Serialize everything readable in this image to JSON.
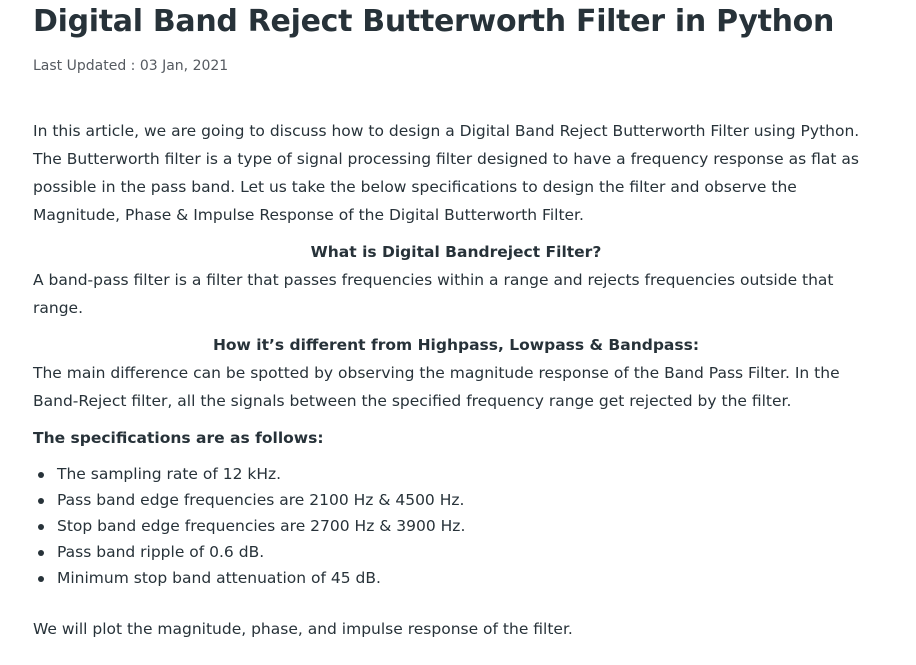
{
  "article": {
    "title": "Digital Band Reject Butterworth Filter in Python",
    "last_updated": "Last Updated : 03 Jan, 2021",
    "intro": "In this article, we are going to discuss how to design a Digital Band Reject Butterworth Filter using Python. The Butterworth filter is a type of signal processing filter designed to have a frequency response as flat as possible in the pass band. Let us take the below specifications to design the filter and observe the Magnitude, Phase & Impulse Response of the Digital Butterworth Filter.",
    "section1_heading": "What is Digital Bandreject Filter?",
    "section1_text": "A band-pass filter is a filter that passes frequencies within a range and rejects frequencies outside that range.",
    "section2_heading": "How it’s different from Highpass, Lowpass & Bandpass:",
    "section2_text": "The main difference can be spotted by observing the magnitude response of the Band Pass Filter. In the Band-Reject filter, all the signals between the specified frequency range get rejected by the filter.",
    "specs_heading": "The specifications are as follows:",
    "specs": [
      "The sampling rate of 12 kHz.",
      "Pass band edge frequencies are 2100 Hz & 4500 Hz.",
      "Stop band edge frequencies are 2700 Hz & 3900 Hz.",
      "Pass band ripple of 0.6 dB.",
      "Minimum stop band attenuation of 45 dB."
    ],
    "closing": "We will plot the magnitude, phase, and impulse response of the filter."
  }
}
